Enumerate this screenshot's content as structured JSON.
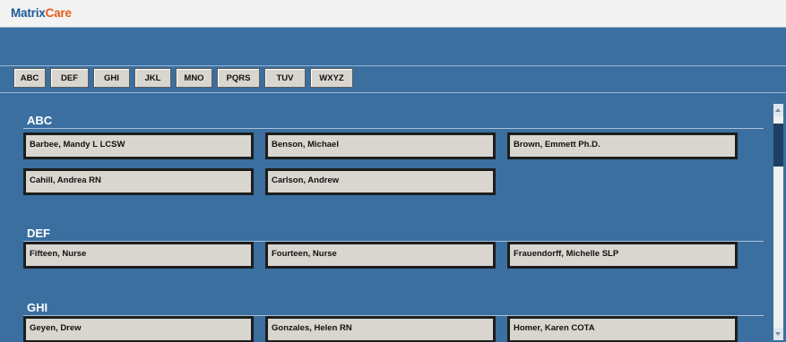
{
  "app": {
    "logo_matrix": "Matrix",
    "logo_care": "Care"
  },
  "tabs": [
    {
      "label": "ABC"
    },
    {
      "label": "DEF"
    },
    {
      "label": "GHI"
    },
    {
      "label": "JKL"
    },
    {
      "label": "MNO"
    },
    {
      "label": "PQRS"
    },
    {
      "label": "TUV"
    },
    {
      "label": "WXYZ"
    }
  ],
  "sections": [
    {
      "title": "ABC",
      "people": [
        "Barbee, Mandy L LCSW",
        "Benson, Michael",
        "Brown, Emmett Ph.D.",
        "Cahill, Andrea RN",
        "Carlson, Andrew"
      ]
    },
    {
      "title": "DEF",
      "people": [
        "Fifteen, Nurse",
        "Fourteen, Nurse",
        "Frauendorff, Michelle SLP"
      ]
    },
    {
      "title": "GHI",
      "people": [
        "Geyen, Drew",
        "Gonzales, Helen RN",
        "Homer, Karen COTA"
      ]
    }
  ],
  "colors": {
    "background": "#3a6fa0",
    "card": "#d9d6cf",
    "brand_blue": "#1f5b96",
    "brand_orange": "#e45c1c"
  }
}
